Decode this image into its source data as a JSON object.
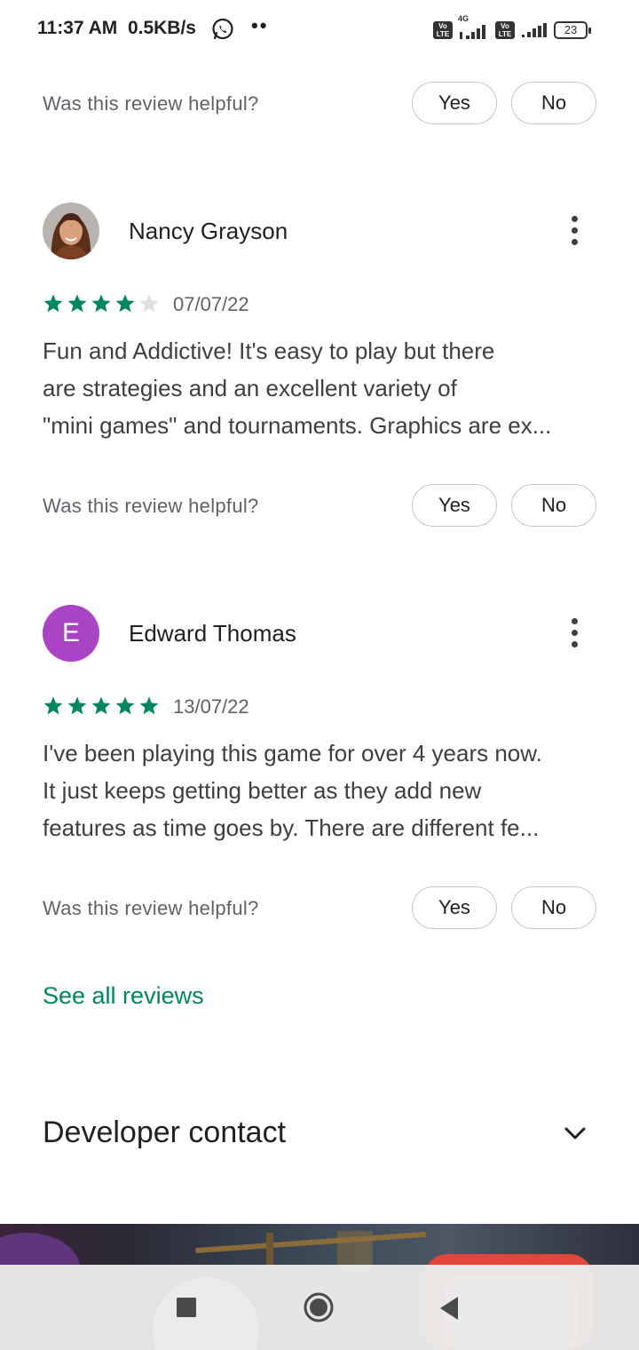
{
  "status_bar": {
    "time": "11:37 AM",
    "speed": "0.5KB/s",
    "network_type": "4G",
    "volte_label": "Vo LTE",
    "battery": "23"
  },
  "helpful": {
    "question": "Was this review helpful?",
    "yes_label": "Yes",
    "no_label": "No"
  },
  "reviews": [
    {
      "name": "Nancy Grayson",
      "rating": 4,
      "max_rating": 5,
      "date": "07/07/22",
      "text_lines": [
        "Fun and Addictive! It's easy to play but there",
        "are strategies and an excellent variety of",
        "\"mini games\" and tournaments. Graphics are ex..."
      ]
    },
    {
      "name": "Edward Thomas",
      "avatar_letter": "E",
      "rating": 5,
      "max_rating": 5,
      "date": "13/07/22",
      "text_lines": [
        "I've been playing this game for over 4 years now.",
        "It just keeps getting better as they add new",
        "features as time goes by. There are different fe..."
      ]
    }
  ],
  "see_all_label": "See all reviews",
  "developer_contact_label": "Developer contact",
  "colors": {
    "accent_green": "#01875f",
    "star_empty": "#e0e0e0",
    "avatar_e": "#a944c4"
  },
  "icons": {
    "whatsapp": "whatsapp-icon",
    "kebab": "more-vert-icon",
    "chevron": "chevron-down-icon",
    "nav_recents": "square-icon",
    "nav_home": "circle-icon",
    "nav_back": "triangle-back-icon"
  }
}
